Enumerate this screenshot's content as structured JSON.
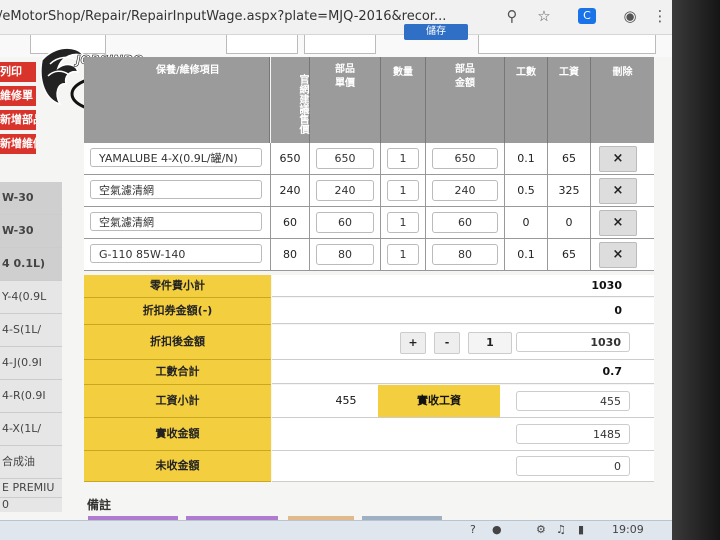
{
  "browser": {
    "url": "/eMotorShop/Repair/RepairInputWage.aspx?plate=MJQ-2016&recor..."
  },
  "logo": {
    "text": "JORSINDO MOTOR CLUB"
  },
  "top_button": {
    "label": "儲存"
  },
  "sidebar": {
    "red_buttons": [
      "列印",
      "維修單",
      "新增部品",
      "新增維修"
    ],
    "items": [
      "W-30",
      "W-30",
      "4 0.1L)",
      "Y-4(0.9L",
      "4-S(1L/",
      "4-J(0.9I",
      "4-R(0.9I",
      "4-X(1L/",
      "合成油",
      "E PREMIU",
      "0"
    ]
  },
  "table": {
    "headers": {
      "item": "保養/維修項目",
      "suggested_price": "官網建議售價",
      "unit_price": "部品單價",
      "qty": "數量",
      "amount": "部品金額",
      "labor_hours": "工數",
      "wage": "工資",
      "delete": "刪除"
    },
    "rows": [
      {
        "item": "YAMALUBE 4-X(0.9L/罐/N)",
        "price": "650",
        "unit": "650",
        "qty": "1",
        "amount": "650",
        "hours": "0.1",
        "wage": "65",
        "del": "×"
      },
      {
        "item": "空氣濾清網",
        "price": "240",
        "unit": "240",
        "qty": "1",
        "amount": "240",
        "hours": "0.5",
        "wage": "325",
        "del": "×"
      },
      {
        "item": "空氣濾清網",
        "price": "60",
        "unit": "60",
        "qty": "1",
        "amount": "60",
        "hours": "0",
        "wage": "0",
        "del": "×"
      },
      {
        "item": "G-110 85W-140",
        "price": "80",
        "unit": "80",
        "qty": "1",
        "amount": "80",
        "hours": "0.1",
        "wage": "65",
        "del": "×"
      }
    ]
  },
  "summary": {
    "parts_subtotal_label": "零件費小計",
    "parts_subtotal": "1030",
    "coupon_label": "折扣券金額(-)",
    "coupon": "0",
    "after_discount_label": "折扣後金額",
    "plus": "+",
    "minus": "-",
    "discount_factor": "1",
    "after_discount": "1030",
    "labor_total_label": "工數合計",
    "labor_total": "0.7",
    "wage_subtotal_label": "工資小計",
    "wage_subtotal": "455",
    "actual_wage_label": "實收工資",
    "actual_wage": "455",
    "received_label": "實收金額",
    "received": "1485",
    "unpaid_label": "未收金額",
    "unpaid": "0"
  },
  "remark_label": "備註",
  "taskbar": {
    "time": "19:09"
  },
  "colors": {
    "header_gray": "#9b9b9b",
    "summary_yellow": "#f3cf3f",
    "red_button": "#d9342b",
    "blue_button": "#2f6fc5"
  }
}
